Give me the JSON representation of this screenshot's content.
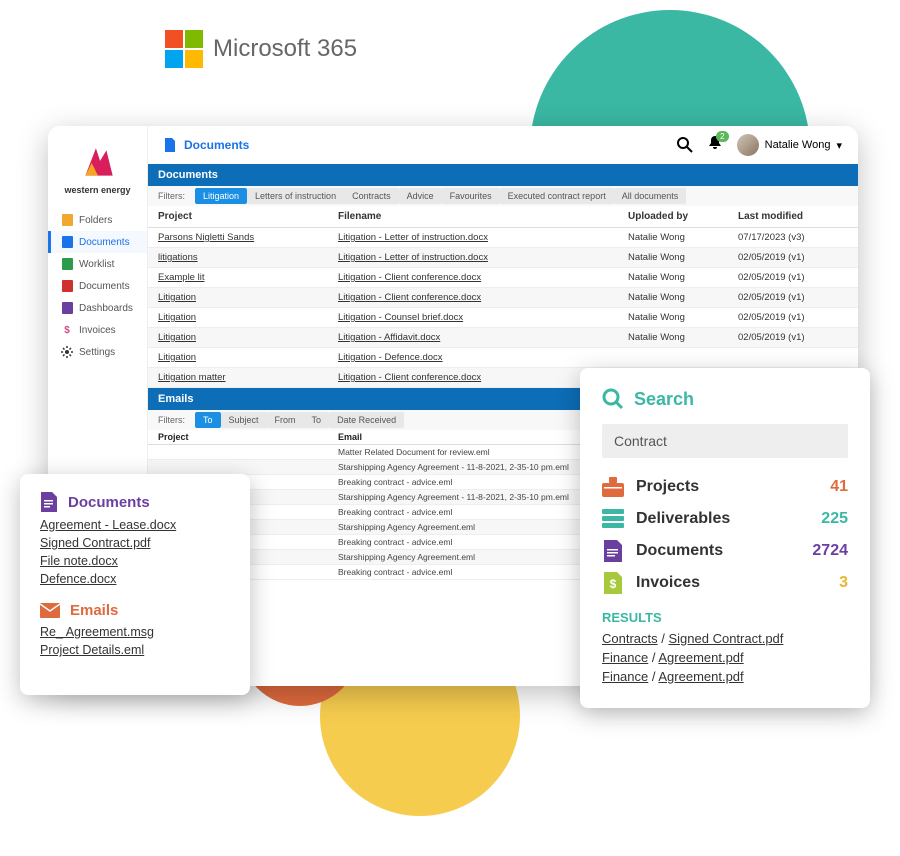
{
  "ms365": "Microsoft 365",
  "logo_text": "western energy",
  "page_title": "Documents",
  "user_name": "Natalie Wong",
  "notif_count": "2",
  "sidebar": {
    "items": [
      {
        "label": "Folders",
        "icon": "folder",
        "color": "#f0a830"
      },
      {
        "label": "Documents",
        "icon": "doc",
        "color": "#1a73e8"
      },
      {
        "label": "Worklist",
        "icon": "sheet",
        "color": "#2c9c4a"
      },
      {
        "label": "Documents",
        "icon": "doc2",
        "color": "#d03030"
      },
      {
        "label": "Dashboards",
        "icon": "chart",
        "color": "#6b3fa0"
      },
      {
        "label": "Invoices",
        "icon": "dollar",
        "color": "#d24a8a"
      },
      {
        "label": "Settings",
        "icon": "gear",
        "color": "#333"
      }
    ]
  },
  "panel": {
    "header": "Documents",
    "filters_label": "Filters:",
    "filters": [
      "Litigation",
      "Letters of instruction",
      "Contracts",
      "Advice",
      "Favourites",
      "Executed contract report",
      "All documents"
    ],
    "cols": {
      "project": "Project",
      "filename": "Filename",
      "uploaded": "Uploaded by",
      "modified": "Last modified"
    },
    "rows": [
      {
        "project": "Parsons Nigletti Sands",
        "filename": "Litigation - Letter of instruction.docx",
        "uploaded": "Natalie Wong",
        "modified": "07/17/2023 (v3)"
      },
      {
        "project": "litigations",
        "filename": "Litigation - Letter of instruction.docx",
        "uploaded": "Natalie Wong",
        "modified": "02/05/2019 (v1)"
      },
      {
        "project": "Example lit",
        "filename": "Litigation - Client conference.docx",
        "uploaded": "Natalie Wong",
        "modified": "02/05/2019 (v1)"
      },
      {
        "project": "Litigation",
        "filename": "Litigation - Client conference.docx",
        "uploaded": "Natalie Wong",
        "modified": "02/05/2019 (v1)"
      },
      {
        "project": "Litigation",
        "filename": "Litigation - Counsel brief.docx",
        "uploaded": "Natalie Wong",
        "modified": "02/05/2019 (v1)"
      },
      {
        "project": "Litigation",
        "filename": "Litigation - Affidavit.docx",
        "uploaded": "Natalie Wong",
        "modified": "02/05/2019 (v1)"
      },
      {
        "project": "Litigation",
        "filename": "Litigation - Defence.docx",
        "uploaded": "",
        "modified": ""
      },
      {
        "project": "Litigation matter",
        "filename": "Litigation - Client conference.docx",
        "uploaded": "",
        "modified": ""
      }
    ],
    "emails_header": "Emails",
    "email_filters_label": "Filters:",
    "email_filters": [
      "To",
      "Subject",
      "From",
      "To",
      "Date Received"
    ],
    "email_cols": {
      "project": "Project",
      "email": "Email"
    },
    "email_rows": [
      {
        "project": "",
        "email": "Matter Related Document for review.eml"
      },
      {
        "project": "",
        "email": "Starshipping Agency Agreement - 11-8-2021, 2-35-10 pm.eml"
      },
      {
        "project": "",
        "email": "Breaking contract - advice.eml"
      },
      {
        "project": "",
        "email": "Starshipping Agency Agreement - 11-8-2021, 2-35-10 pm.eml"
      },
      {
        "project": "",
        "email": "Breaking contract - advice.eml"
      },
      {
        "project": "",
        "email": "Starshipping Agency Agreement.eml"
      },
      {
        "project": "",
        "email": "Breaking contract - advice.eml"
      },
      {
        "project": "",
        "email": "Starshipping Agency Agreement.eml"
      },
      {
        "project": "",
        "email": "Breaking contract - advice.eml"
      }
    ]
  },
  "left_card": {
    "docs_title": "Documents",
    "docs": [
      "Agreement - Lease.docx",
      "Signed Contract.pdf",
      "File note.docx",
      "Defence.docx"
    ],
    "emails_title": "Emails",
    "emails": [
      "Re_ Agreement.msg",
      "Project Details.eml"
    ]
  },
  "search": {
    "title": "Search",
    "query": "Contract",
    "stats": [
      {
        "label": "Projects",
        "value": "41",
        "cls": "projects"
      },
      {
        "label": "Deliverables",
        "value": "225",
        "cls": "deliv"
      },
      {
        "label": "Documents",
        "value": "2724",
        "cls": "docs"
      },
      {
        "label": "Invoices",
        "value": "3",
        "cls": "inv"
      }
    ],
    "results_hd": "RESULTS",
    "results": [
      {
        "folder": "Contracts",
        "file": "Signed Contract.pdf"
      },
      {
        "folder": "Finance",
        "file": "Agreement.pdf"
      },
      {
        "folder": "Finance",
        "file": "Agreement.pdf"
      }
    ]
  }
}
